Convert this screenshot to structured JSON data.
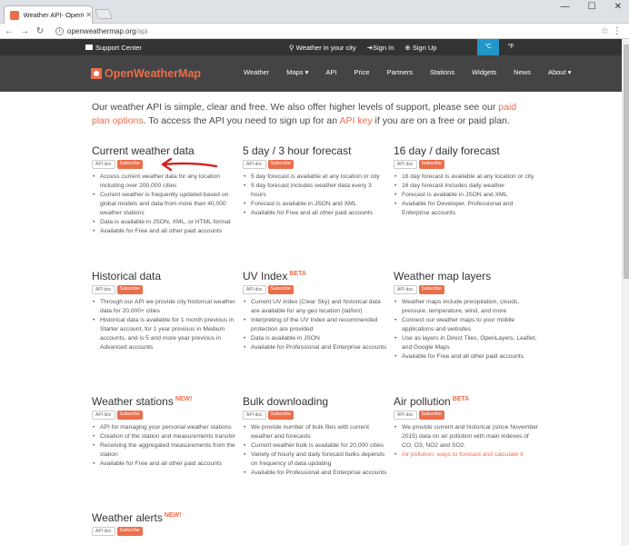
{
  "browser": {
    "tab_title": "Weather API- OpenWeathe",
    "url_domain": "openweathermap.org",
    "url_path": "/api"
  },
  "topbar": {
    "support": "Support Center",
    "weather_city": "Weather in your city",
    "sign_in": "Sign In",
    "sign_up": "Sign Up",
    "unit_c": "°C",
    "unit_f": "°F"
  },
  "nav": {
    "logo": "OpenWeatherMap",
    "items": [
      "Weather",
      "Maps ▾",
      "API",
      "Price",
      "Partners",
      "Stations",
      "Widgets",
      "News",
      "About ▾"
    ]
  },
  "intro": {
    "part1": "Our weather API is simple, clear and free. We also offer higher levels of support, please see our ",
    "link1": "paid plan options",
    "part2": ". To access the API you need to sign up for an ",
    "link2": "API key",
    "part3": " if you are on a free or paid plan."
  },
  "buttons": {
    "api_doc": "API doc",
    "subscribe": "Subscribe"
  },
  "sections": [
    {
      "title": "Current weather data",
      "badge": "",
      "bullets": [
        "Access current weather data for any location including over 200,000 cities",
        "Current weather is frequently updated based on global models and data from more than 40,000 weather stations",
        "Data is available in JSON, XML, or HTML format",
        "Available for Free and all other paid accounts"
      ]
    },
    {
      "title": "5 day / 3 hour forecast",
      "badge": "",
      "bullets": [
        "5 day forecast is available at any location or city",
        "5 day forecast includes weather data every 3 hours",
        "Forecast is available in JSON and XML",
        "Available for Free and all other paid accounts"
      ]
    },
    {
      "title": "16 day / daily forecast",
      "badge": "",
      "bullets": [
        "16 day forecast is available at any location or city",
        "16 day forecast includes daily weather",
        "Forecast is available in JSON and XML",
        "Available for Developer, Professional and Enterprise accounts"
      ]
    },
    {
      "title": "Historical data",
      "badge": "",
      "bullets": [
        "Through our API we provide city historical weather data for 20,000+ cities",
        "Historical data is available for 1 month previous in Starter account, for 1 year previous in Medium accounts, and is 5 and more year previous in Advanced accounts"
      ]
    },
    {
      "title": "UV Index",
      "badge": "BETA",
      "bullets": [
        "Current UV index (Clear Sky) and historical data are available for any geo location (lat/lon)",
        "Interpreting of the UV Index and recommended protection are provided",
        "Data is available in JSON",
        "Available for Professional and Enterprise accounts"
      ]
    },
    {
      "title": "Weather map layers",
      "badge": "",
      "bullets": [
        "Weather maps include precipitation, clouds, pressure, temperature, wind, and more",
        "Connect our weather maps to your mobile applications and websites",
        "Use as layers in Direct Tiles, OpenLayers, Leaflet, and Google Maps",
        "Available for Free and all other paid accounts"
      ]
    },
    {
      "title": "Weather stations",
      "badge": "NEW!",
      "bullets": [
        "API for managing your personal weather stations",
        "Creation of the station and measurements transfer",
        "Receiving the aggregated measurements from the station",
        "Available for Free and all other paid accounts"
      ]
    },
    {
      "title": "Bulk downloading",
      "badge": "",
      "bullets": [
        "We provide number of bulk files with current weather and forecasts",
        "Current weather bulk is available for 20,000 cities",
        "Variety of hourly and daily forecast bulks depends on frequency of data updating",
        "Available for Professional and Enterprise accounts"
      ]
    },
    {
      "title": "Air pollution",
      "badge": "BETA",
      "bullets": [
        "We provide current and historical (since November 2015) data on air pollution with main indexes of CO, O3, NO2 and SO2.",
        "Air pollution: ways to forecast and calculate it"
      ]
    },
    {
      "title": "Weather alerts",
      "badge": "NEW!",
      "bullets": []
    }
  ],
  "colors": {
    "accent": "#eb6e4b",
    "nav_bg": "#444444",
    "topbar_bg": "#333333",
    "unit_active": "#2196c8"
  }
}
